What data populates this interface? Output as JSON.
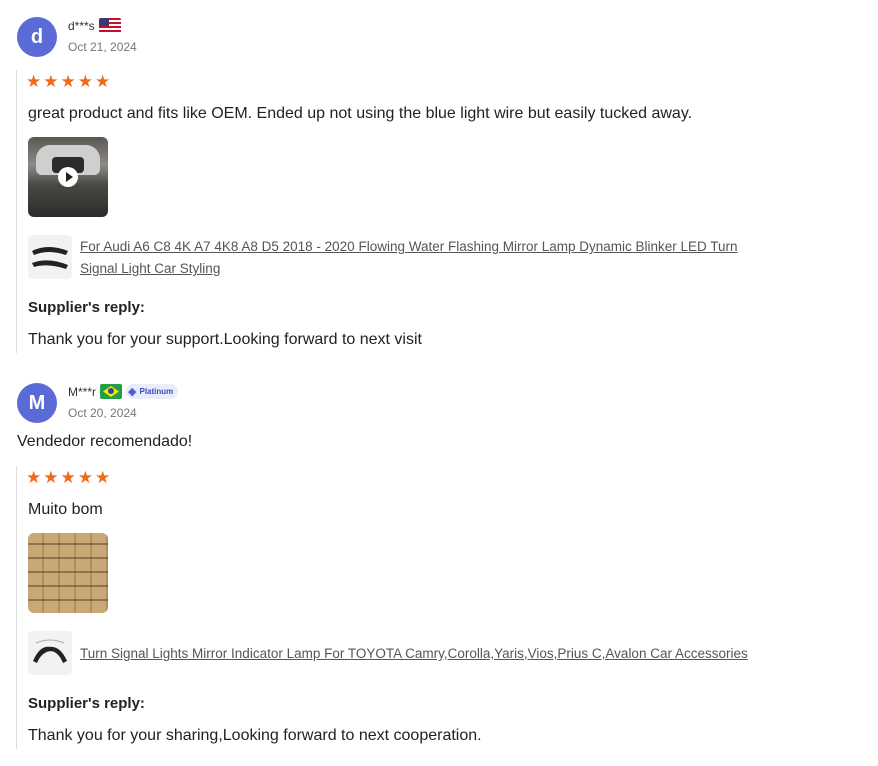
{
  "reviews": [
    {
      "avatar_letter": "d",
      "username": "d***s",
      "flag": "us-flag-icon",
      "date": "Oct 21, 2024",
      "rating": 5,
      "comment": "great product and fits like OEM. Ended up not using the blue light wire but easily tucked away.",
      "media": "video",
      "product_title_line1": "For Audi A6 C8 4K A7 4K8 A8 D5 2018 - 2020 Flowing Water Flashing Mirror Lamp Dynamic Blinker LED Turn",
      "product_title_line2": "Signal Light Car Styling",
      "reply_title": "Supplier's reply:",
      "reply_text": "Thank you for your support.Looking forward to next visit"
    },
    {
      "avatar_letter": "M",
      "username": "M***r",
      "flag": "br-flag-icon",
      "badge": "Platinum",
      "date": "Oct 20, 2024",
      "store_comment": "Vendedor recomendado!",
      "rating": 5,
      "comment": "Muito bom",
      "media": "image",
      "product_title_line1": "Turn Signal Lights Mirror Indicator Lamp For TOYOTA Camry,Corolla,Yaris,Vios,Prius C,Avalon Car Accessories",
      "reply_title": "Supplier's reply:",
      "reply_text": "Thank you for your sharing,Looking forward to next cooperation."
    }
  ],
  "colors": {
    "avatar": "#5a6ad6",
    "star": "#f06a1a",
    "badge_text": "#3a4fb8"
  }
}
